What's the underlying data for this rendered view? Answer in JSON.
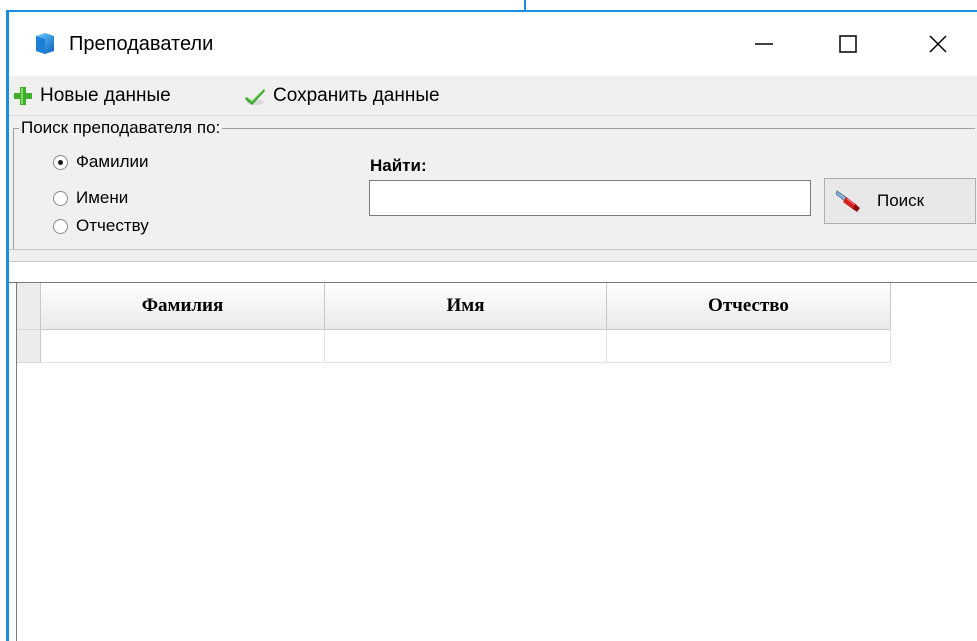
{
  "window": {
    "title": "Преподаватели",
    "accent_color": "#1b8de0",
    "icons": {
      "app": "app-icon",
      "minimize": "minimize-icon",
      "maximize": "maximize-icon",
      "close": "close-icon"
    }
  },
  "toolbar": {
    "new_label": "Новые данные",
    "new_icon": "plus-icon",
    "save_label": "Сохранить данные",
    "save_icon": "checkmark-icon"
  },
  "search": {
    "group_label": "Поиск преподавателя по:",
    "options": [
      {
        "label": "Фамилии",
        "checked": true
      },
      {
        "label": "Имени",
        "checked": false
      },
      {
        "label": "Отчеству",
        "checked": false
      }
    ],
    "find_label": "Найти:",
    "input_value": "",
    "button_label": "Поиск",
    "button_icon": "flashlight-icon"
  },
  "grid": {
    "columns": [
      "Фамилия",
      "Имя",
      "Отчество"
    ],
    "rows": [
      [
        "",
        "",
        ""
      ]
    ]
  }
}
